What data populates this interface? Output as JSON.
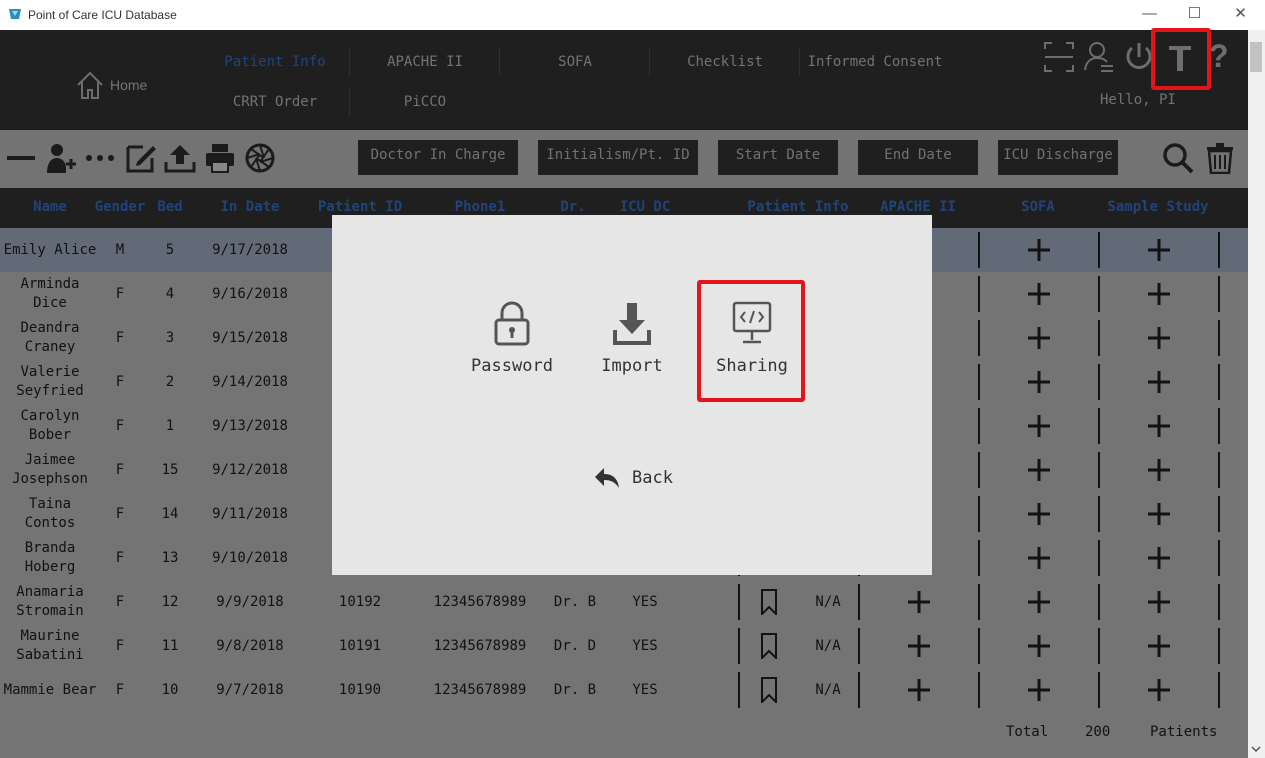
{
  "window": {
    "title": "Point of Care ICU Database",
    "minimize": "—",
    "maximize": "☐",
    "close": "✕"
  },
  "nav": {
    "home": "Home",
    "tabs_row1": [
      "Patient Info",
      "APACHE II",
      "SOFA",
      "Checklist",
      "Informed Consent"
    ],
    "tabs_row2": [
      "CRRT Order",
      "PiCCO"
    ],
    "active_tab": "Patient Info",
    "greeting": "Hello, PI",
    "help": "?"
  },
  "filters": [
    "Doctor In Charge",
    "Initialism/Pt. ID",
    "Start Date",
    "End Date",
    "ICU Discharge"
  ],
  "table": {
    "headers": [
      "Name",
      "Gender",
      "Bed",
      "In Date",
      "Patient ID",
      "Phone1",
      "Dr.",
      "ICU DC",
      "Patient Info",
      "APACHE II",
      "SOFA",
      "Sample Study"
    ],
    "rows": [
      {
        "name": "Emily Alice",
        "gender": "M",
        "bed": "5",
        "in_date": "9/17/2018"
      },
      {
        "name": "Arminda Dice",
        "gender": "F",
        "bed": "4",
        "in_date": "9/16/2018"
      },
      {
        "name": "Deandra\nCraney",
        "gender": "F",
        "bed": "3",
        "in_date": "9/15/2018"
      },
      {
        "name": "Valerie\nSeyfried",
        "gender": "F",
        "bed": "2",
        "in_date": "9/14/2018"
      },
      {
        "name": "Carolyn\nBober",
        "gender": "F",
        "bed": "1",
        "in_date": "9/13/2018"
      },
      {
        "name": "Jaimee\nJosephson",
        "gender": "F",
        "bed": "15",
        "in_date": "9/12/2018"
      },
      {
        "name": "Taina Contos",
        "gender": "F",
        "bed": "14",
        "in_date": "9/11/2018"
      },
      {
        "name": "Branda\nHoberg",
        "gender": "F",
        "bed": "13",
        "in_date": "9/10/2018"
      },
      {
        "name": "Anamaria\nStromain",
        "gender": "F",
        "bed": "12",
        "in_date": "9/9/2018",
        "patient_id": "10192",
        "phone": "12345678989",
        "dr": "Dr. B",
        "icu_dc": "YES",
        "na": "N/A"
      },
      {
        "name": "Maurine\nSabatini",
        "gender": "F",
        "bed": "11",
        "in_date": "9/8/2018",
        "patient_id": "10191",
        "phone": "12345678989",
        "dr": "Dr. D",
        "icu_dc": "YES",
        "na": "N/A"
      },
      {
        "name": "Mammie Bear",
        "gender": "F",
        "bed": "10",
        "in_date": "9/7/2018",
        "patient_id": "10190",
        "phone": "12345678989",
        "dr": "Dr. B",
        "icu_dc": "YES",
        "na": "N/A"
      }
    ]
  },
  "footer": {
    "total_label": "Total",
    "total_count": "200",
    "unit": "Patients"
  },
  "dialog": {
    "options": [
      {
        "label": "Password",
        "icon": "lock-icon"
      },
      {
        "label": "Import",
        "icon": "download-icon"
      },
      {
        "label": "Sharing",
        "icon": "code-monitor-icon"
      }
    ],
    "back": "Back"
  },
  "colors": {
    "accent": "#3f7fe8",
    "dark": "#3b3b3b",
    "highlight": "#e4141a",
    "selected_row": "#bcc9e0"
  }
}
